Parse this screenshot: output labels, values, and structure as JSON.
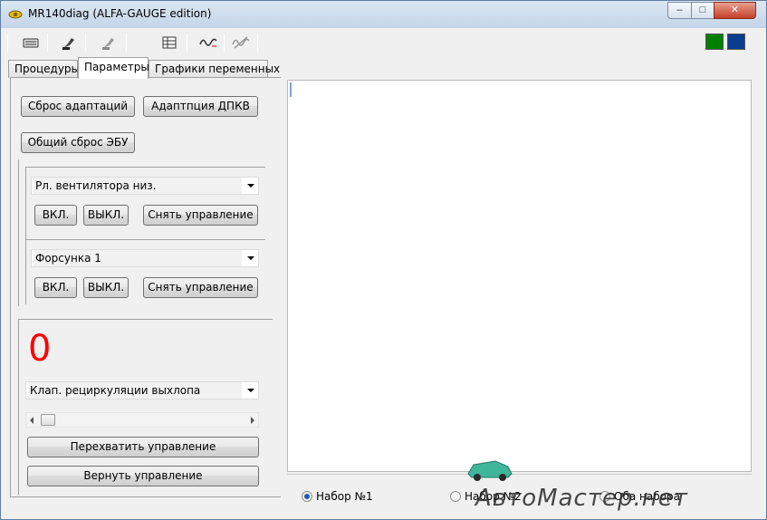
{
  "window": {
    "title": "MR140diag (ALFA-GAUGE edition)",
    "controls": {
      "minimize": "–",
      "maximize": "□",
      "close": "✕"
    }
  },
  "toolbar": {
    "icons": [
      "keyboard-icon",
      "connect-icon",
      "disconnect-icon",
      "table-icon",
      "signal-wave-icon",
      "signal-off-icon"
    ],
    "indicators": [
      {
        "name": "green-indicator",
        "color": "#008000"
      },
      {
        "name": "blue-indicator",
        "color": "#0a3d8f"
      }
    ]
  },
  "tabs": [
    {
      "label": "Процедуры",
      "active": false
    },
    {
      "label": "Параметры",
      "active": true
    },
    {
      "label": "Графики переменных",
      "active": false
    }
  ],
  "procedures": {
    "reset_adaptations": "Сброс адаптаций",
    "adapt_dpkv": "Адаптпция ДПКВ",
    "ecu_reset": "Общий сброс ЭБУ"
  },
  "control1": {
    "selected": "Рл. вентилятора низ.",
    "on": "ВКЛ.",
    "off": "ВЫКЛ.",
    "release": "Снять управление"
  },
  "control2": {
    "selected": "Форсунка 1",
    "on": "ВКЛ.",
    "off": "ВЫКЛ.",
    "release": "Снять управление"
  },
  "actuator": {
    "value": "0",
    "value_color": "#ff0000",
    "selected": "Клап. рециркуляции выхлопа",
    "intercept": "Перехватить управление",
    "return": "Вернуть управление"
  },
  "radio_sets": [
    {
      "label": "Набор №1",
      "selected": true
    },
    {
      "label": "Набор №2",
      "selected": false
    },
    {
      "label": "Оба набора",
      "selected": false
    }
  ],
  "watermark": "АвтоМастер.нет"
}
